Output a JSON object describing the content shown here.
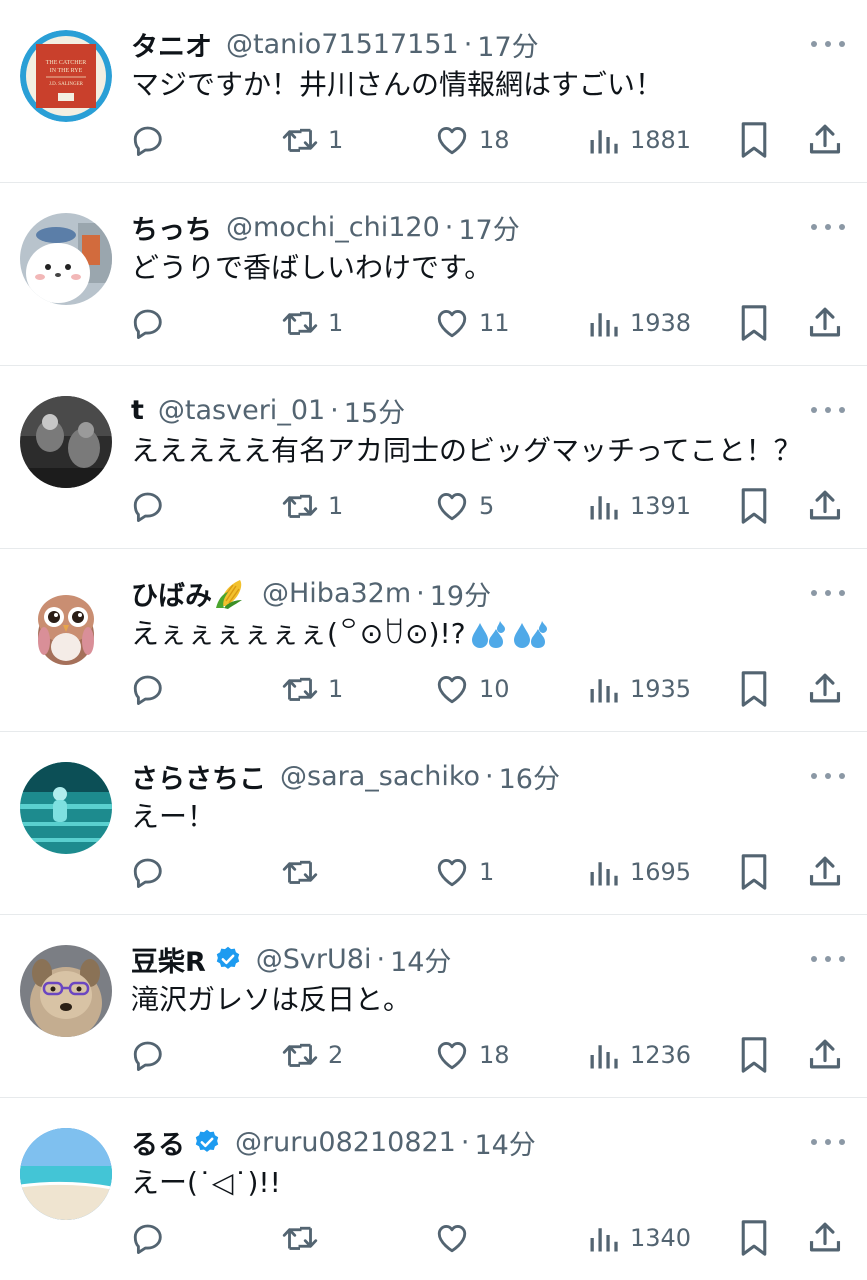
{
  "posts": [
    {
      "display_name": "タニオ",
      "handle": "@tanio71517151",
      "time": "17分",
      "text": "マジですか！井川さんの情報網はすごい！",
      "replies": "",
      "retweets": "1",
      "likes": "18",
      "views": "1881",
      "verified": false,
      "avatar": {
        "kind": "book-cover",
        "colors": [
          "#2a9fd6",
          "#c9402c",
          "#f3efe2"
        ],
        "text_lines": [
          "THE CATCHER",
          "IN THE RYE",
          "J.D. SALINGER"
        ]
      }
    },
    {
      "display_name": "ちっち",
      "handle": "@mochi_chi120",
      "time": "17分",
      "text": "どうりで香ばしいわけです。",
      "replies": "",
      "retweets": "1",
      "likes": "11",
      "views": "1938",
      "verified": false,
      "avatar": {
        "kind": "character",
        "colors": [
          "#b8c3cc",
          "#ffffff",
          "#5b7ea8"
        ]
      }
    },
    {
      "display_name": "t",
      "handle": "@tasveri_01",
      "time": "15分",
      "text": "えええええ有名アカ同士のビッグマッチってこと！？",
      "replies": "",
      "retweets": "1",
      "likes": "5",
      "views": "1391",
      "verified": false,
      "avatar": {
        "kind": "monochrome-photo",
        "colors": [
          "#2c2c2c",
          "#7a7a7a",
          "#c7c7c7"
        ]
      }
    },
    {
      "display_name": "ひばみ",
      "name_emoji": "corn-emoji",
      "handle": "@Hiba32m",
      "time": "19分",
      "text": "えぇぇぇぇぇぇ(꒪⊙ꇴ⊙)!?",
      "text_emoji": "sweat-droplets-emoji",
      "replies": "",
      "retweets": "1",
      "likes": "10",
      "views": "1935",
      "verified": false,
      "avatar": {
        "kind": "owl",
        "colors": [
          "#f4ece7",
          "#a5705a",
          "#d98f98"
        ]
      }
    },
    {
      "display_name": "さらさちこ",
      "handle": "@sara_sachiko",
      "time": "16分",
      "text": "えー！",
      "replies": "",
      "retweets": "",
      "likes": "1",
      "views": "1695",
      "verified": false,
      "avatar": {
        "kind": "teal-photo",
        "colors": [
          "#1d8b8e",
          "#5ad0cf",
          "#0c4f56"
        ]
      }
    },
    {
      "display_name": "豆柴R",
      "handle": "@SvrU8i",
      "time": "14分",
      "text": "滝沢ガレソは反日と。",
      "replies": "",
      "retweets": "2",
      "likes": "18",
      "views": "1236",
      "verified": true,
      "avatar": {
        "kind": "dog",
        "colors": [
          "#c4ad90",
          "#8a7256",
          "#6b46c1"
        ]
      }
    },
    {
      "display_name": "るる",
      "handle": "@ruru08210821",
      "time": "14分",
      "text": "えー(˙◁˙)!!",
      "replies": "",
      "retweets": "",
      "likes": "",
      "views": "1340",
      "verified": true,
      "avatar": {
        "kind": "beach",
        "colors": [
          "#2e88d6",
          "#43c5d6",
          "#efe4d0"
        ]
      }
    }
  ],
  "colors": {
    "text_primary": "#0f1419",
    "text_secondary": "#536471",
    "divider": "#e7eaec",
    "verified": "#1d9bf0",
    "background": "#ffffff"
  },
  "icons": {
    "reply": "speech-bubble-icon",
    "retweet": "retweet-arrows-icon",
    "like": "heart-icon",
    "views": "bar-chart-icon",
    "bookmark": "bookmark-icon",
    "share": "share-upload-icon",
    "more": "more-dots-icon",
    "verified": "verified-badge-icon"
  }
}
